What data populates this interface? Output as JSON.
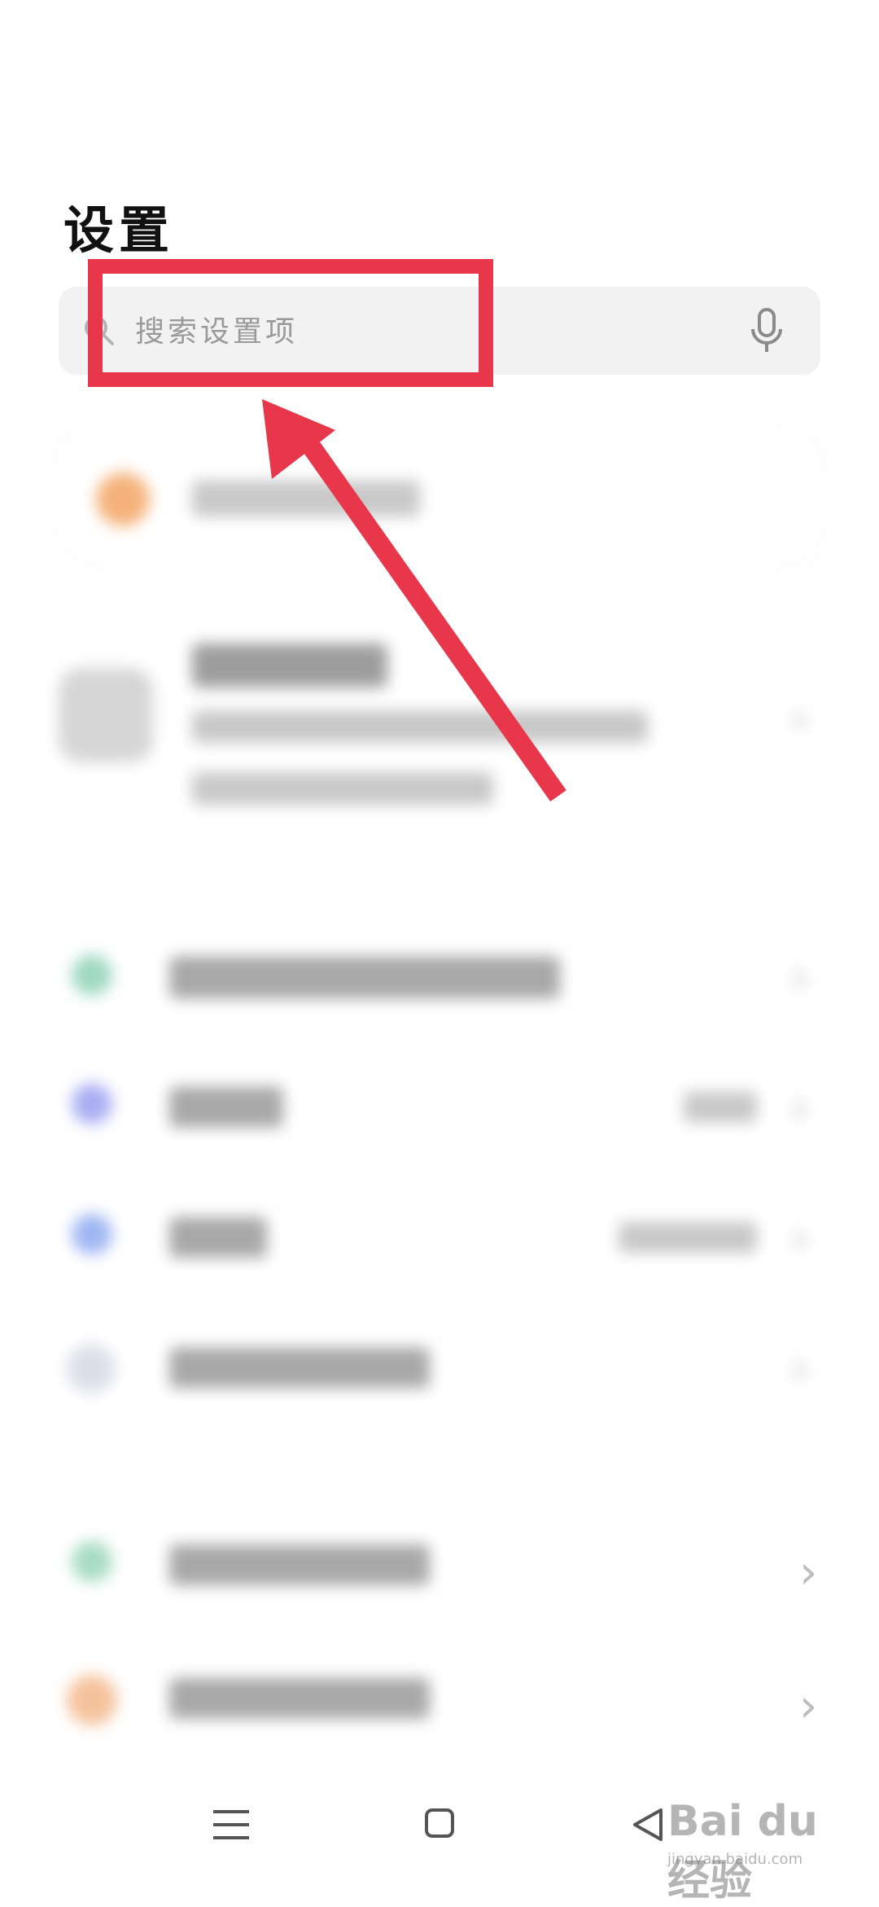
{
  "page": {
    "title": "设置"
  },
  "search": {
    "placeholder": "搜索设置项"
  },
  "nav": {
    "menu": "menu-icon",
    "home": "home-icon",
    "back": "back-icon"
  },
  "watermark": {
    "main": "Bai du 经验",
    "sub": "jingyan.baidu.com"
  },
  "colors": {
    "highlight": "#e8374a",
    "search_bg": "#f2f2f2",
    "background": "#ffffff"
  }
}
